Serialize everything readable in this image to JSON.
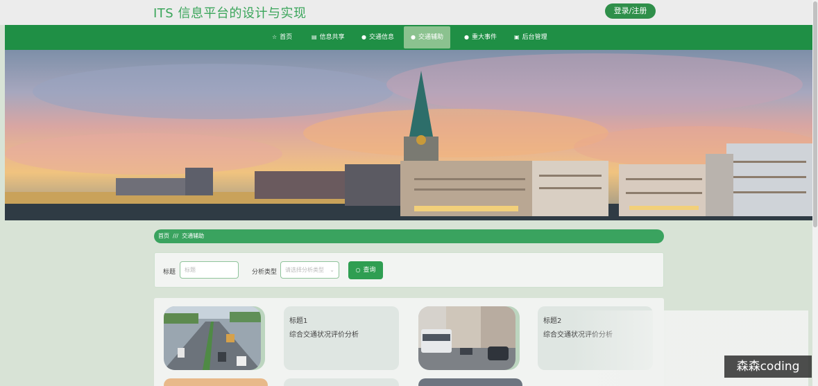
{
  "header": {
    "site_title": "ITS 信息平台的设计与实现",
    "login_label": "登录/注册"
  },
  "nav": {
    "items": [
      {
        "icon": "star-icon",
        "glyph": "☆",
        "label": "首页"
      },
      {
        "icon": "trash-icon",
        "glyph": "▤",
        "label": "信息共享"
      },
      {
        "icon": "info-icon",
        "glyph": "●",
        "label": "交通信息"
      },
      {
        "icon": "question-icon",
        "glyph": "●",
        "label": "交通辅助"
      },
      {
        "icon": "alert-icon",
        "glyph": "●",
        "label": "重大事件"
      },
      {
        "icon": "lock-icon",
        "glyph": "▣",
        "label": "后台管理"
      }
    ],
    "active_index": 3
  },
  "breadcrumb": {
    "home": "首页",
    "separator": "///",
    "current": "交通辅助"
  },
  "search": {
    "title_label": "标题",
    "title_placeholder": "标题",
    "type_label": "分析类型",
    "type_placeholder": "请选择分析类型",
    "query_label": "查询"
  },
  "cards": [
    {
      "title": "标题1",
      "type": "综合交通状况评价分析"
    },
    {
      "title": "标题2",
      "type": "综合交通状况评价分析"
    }
  ],
  "watermark": "森森coding",
  "colors": {
    "primary_green": "#1f8f45",
    "title_green": "#3aa55a",
    "active_nav": "#8bc28f",
    "breadcrumb": "#3aa35f"
  }
}
